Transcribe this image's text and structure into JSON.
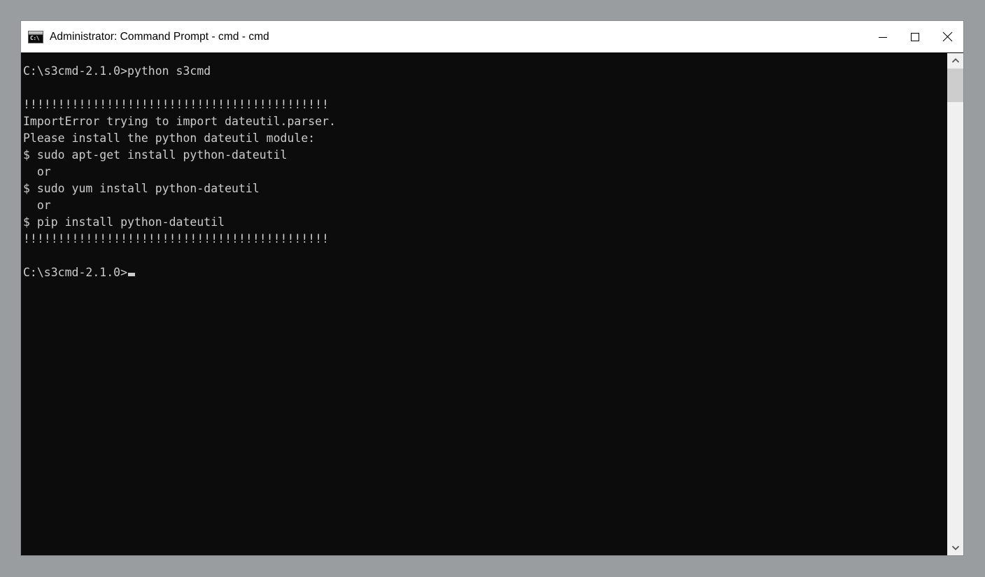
{
  "window": {
    "title": "Administrator: Command Prompt - cmd - cmd",
    "icon": "cmd-console-icon",
    "icon_glyph": "C:\\",
    "background_color": "#0c0c0c",
    "text_color": "#cccccc",
    "desktop_color": "#9a9d9f"
  },
  "titlebar": {
    "minimize_label": "Minimize",
    "maximize_label": "Maximize",
    "close_label": "Close"
  },
  "console": {
    "lines": [
      "C:\\s3cmd-2.1.0>python s3cmd",
      "",
      "!!!!!!!!!!!!!!!!!!!!!!!!!!!!!!!!!!!!!!!!!!!!",
      "ImportError trying to import dateutil.parser.",
      "Please install the python dateutil module:",
      "$ sudo apt-get install python-dateutil",
      "  or",
      "$ sudo yum install python-dateutil",
      "  or",
      "$ pip install python-dateutil",
      "!!!!!!!!!!!!!!!!!!!!!!!!!!!!!!!!!!!!!!!!!!!!",
      ""
    ],
    "prompt": "C:\\s3cmd-2.1.0>",
    "cursor": "block-underscore"
  },
  "scrollbar": {
    "up_label": "Scroll up",
    "down_label": "Scroll down",
    "thumb_label": "Scrollbar thumb"
  }
}
